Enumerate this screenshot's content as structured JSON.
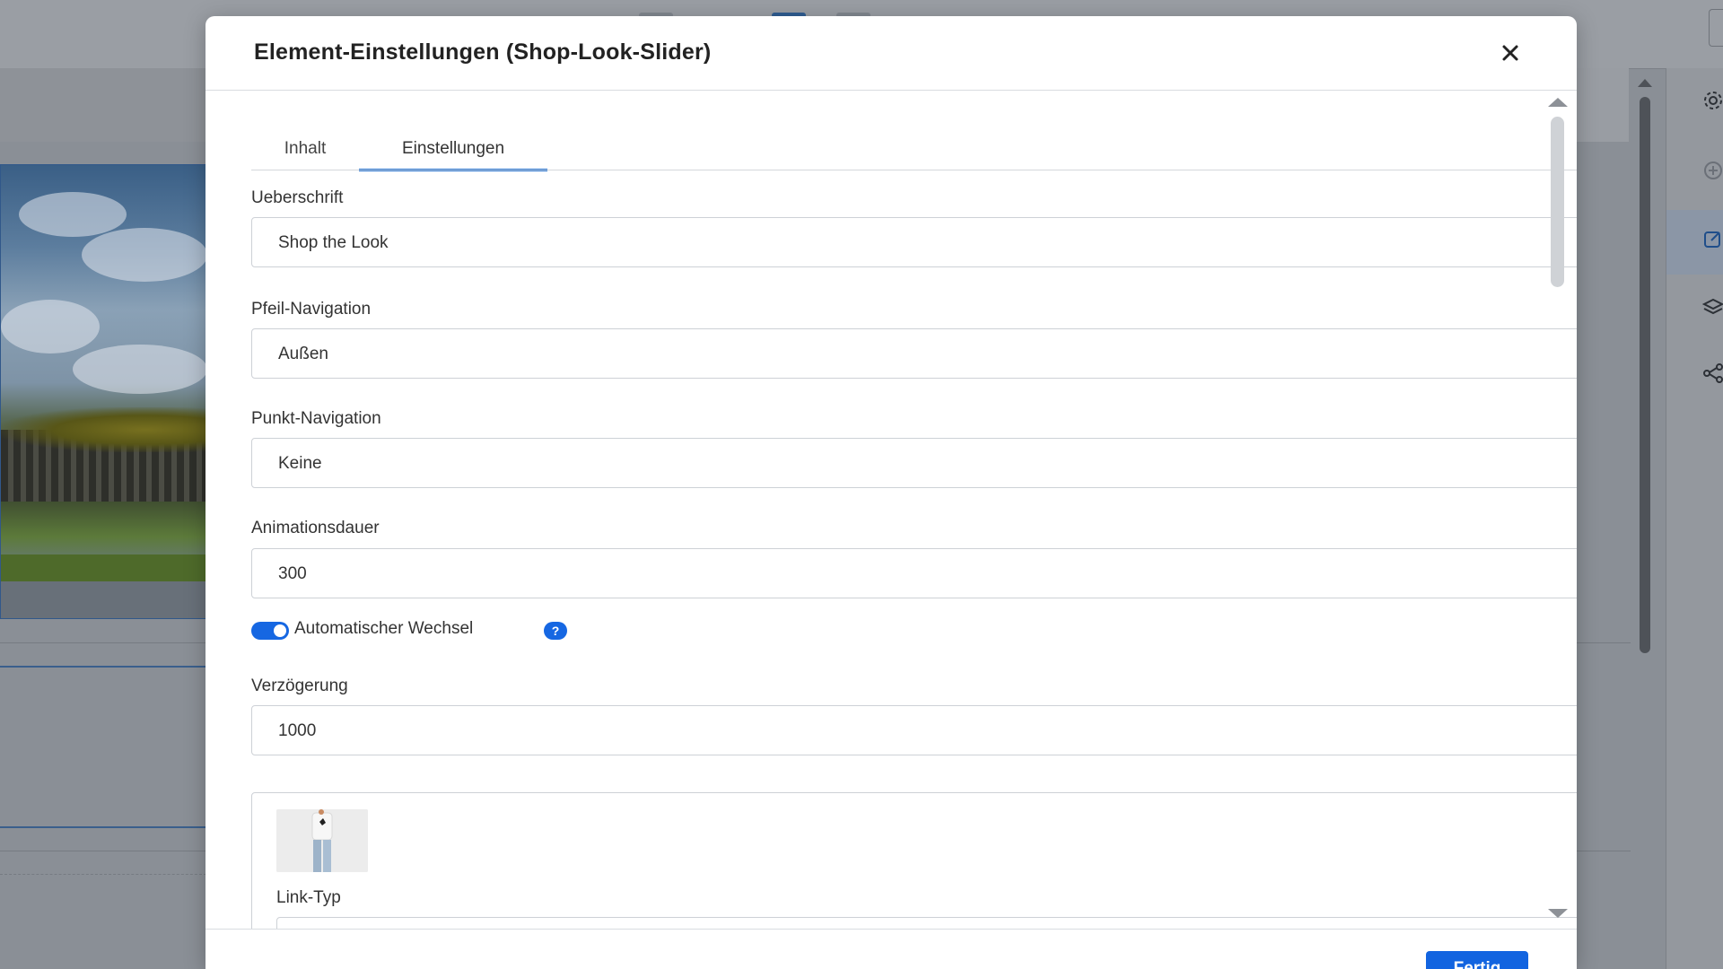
{
  "modal": {
    "title": "Element-Einstellungen (Shop-Look-Slider)",
    "done_label": "Fertig"
  },
  "tabs": [
    {
      "label": "Inhalt",
      "active": false
    },
    {
      "label": "Einstellungen",
      "active": true
    }
  ],
  "fields": {
    "heading": {
      "label": "Ueberschrift",
      "value": "Shop the Look"
    },
    "arrow_nav": {
      "label": "Pfeil-Navigation",
      "value": "Außen"
    },
    "dot_nav": {
      "label": "Punkt-Navigation",
      "value": "Keine"
    },
    "animation_duration": {
      "label": "Animationsdauer",
      "value": "300"
    },
    "auto_switch": {
      "label": "Automatischer Wechsel",
      "enabled": true
    },
    "delay": {
      "label": "Verzögerung",
      "value": "1000"
    }
  },
  "slide_card": {
    "link_type_label": "Link-Typ"
  },
  "help_icon_text": "?",
  "colors": {
    "accent": "#1264e0",
    "help_badge": "#1667e2",
    "tab_underline": "#1f6fd1"
  },
  "icons": {
    "close": "close-icon",
    "help": "help-icon",
    "chevron": "chevron-down-icon",
    "spinner": "number-stepper",
    "sidebar": [
      "gear-icon",
      "plus-circle-icon",
      "edit-icon",
      "layers-icon",
      "share-icon"
    ]
  }
}
